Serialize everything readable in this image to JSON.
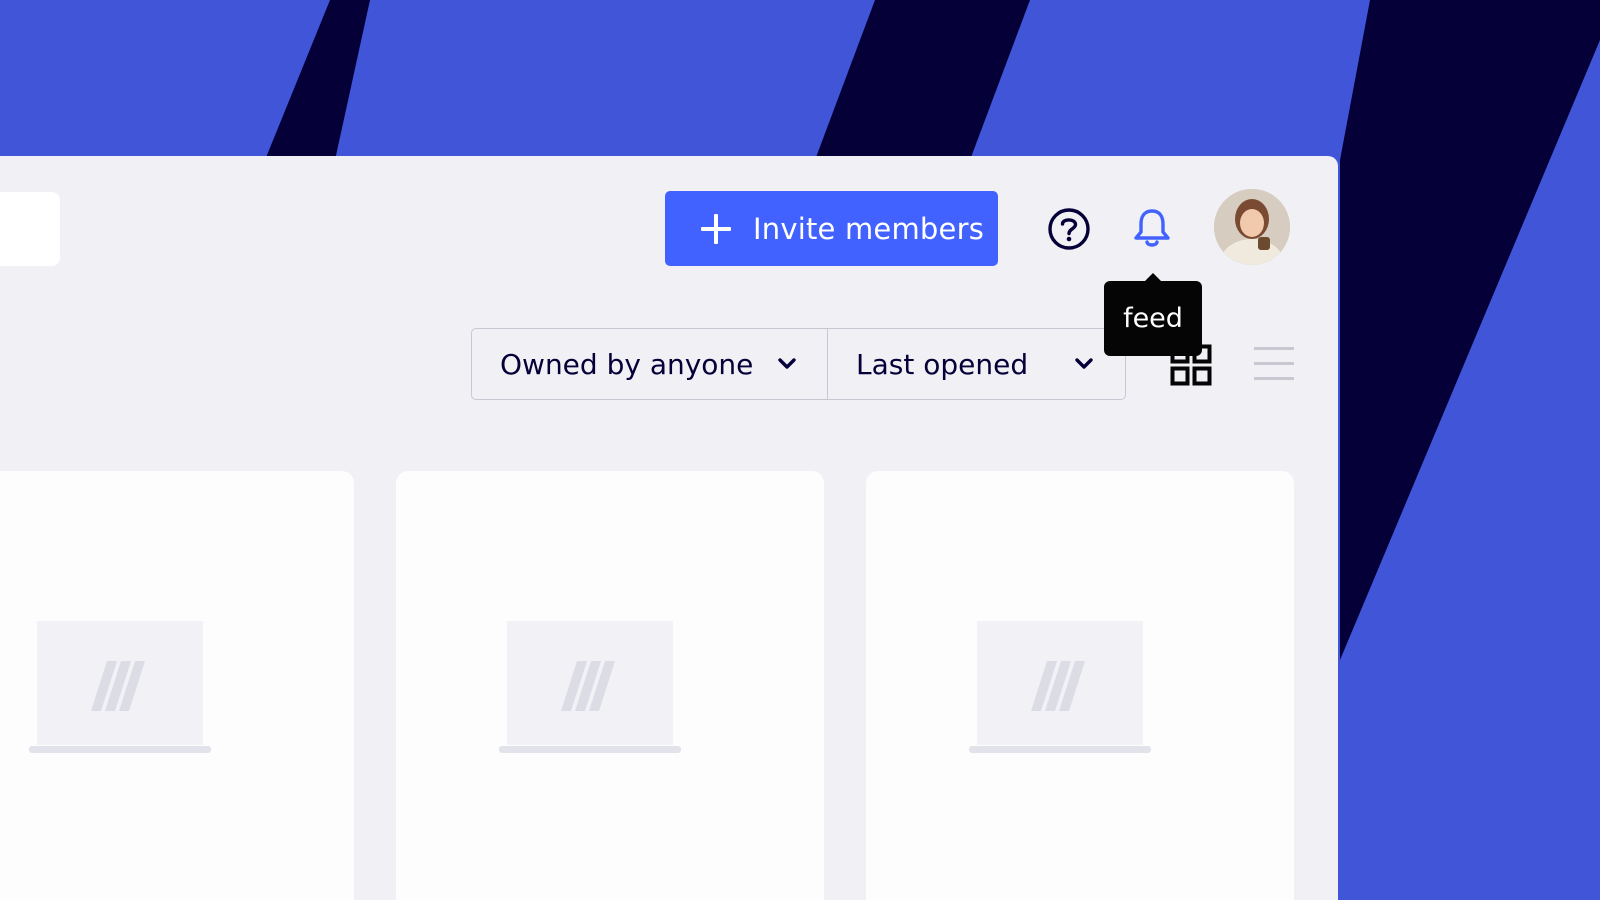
{
  "colors": {
    "background_blue": "#4055d8",
    "stripe_navy": "#050038",
    "panel": "#f0f0f5",
    "accent": "#4262ff",
    "text_dark": "#050038",
    "tooltip_bg": "#050505"
  },
  "header": {
    "invite_label": "Invite members",
    "invite_icon": "plus-icon",
    "help_icon": "question-circle-icon",
    "notifications_icon": "bell-icon",
    "avatar": "user-avatar"
  },
  "tooltip": {
    "text": "feed"
  },
  "filters": {
    "owner_label": "Owned by anyone",
    "sort_label": "Last opened"
  },
  "view_toggle": {
    "grid_icon": "grid-view-icon",
    "list_icon": "list-view-icon"
  },
  "boards": [
    {
      "placeholder_icon": "miro-logo-icon"
    },
    {
      "placeholder_icon": "miro-logo-icon"
    },
    {
      "placeholder_icon": "miro-logo-icon"
    }
  ]
}
